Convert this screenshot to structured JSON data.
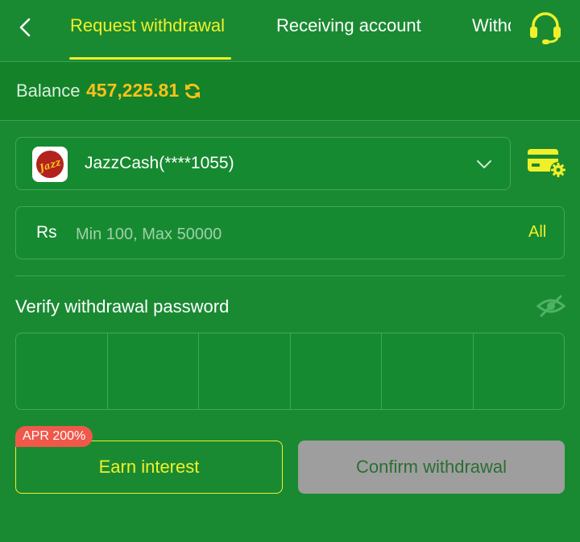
{
  "header": {
    "back_icon": "chevron-left-icon",
    "tabs": [
      {
        "label": "Request withdrawal",
        "active": true
      },
      {
        "label": "Receiving account",
        "active": false
      },
      {
        "label": "Withdrawal history",
        "active": false
      }
    ],
    "support_icon": "headset-icon"
  },
  "balance": {
    "label": "Balance",
    "value": "457,225.81",
    "refresh_icon": "refresh-icon"
  },
  "account": {
    "logo_text": "Jazz",
    "name": "JazzCash(****1055)",
    "dropdown_icon": "chevron-down-icon",
    "manage_icon": "card-settings-icon"
  },
  "amount": {
    "currency": "Rs",
    "placeholder": "Min 100, Max 50000",
    "value": "",
    "all_label": "All"
  },
  "password": {
    "label": "Verify withdrawal password",
    "visibility_icon": "eye-off-icon",
    "digits": [
      "",
      "",
      "",
      "",
      "",
      ""
    ]
  },
  "actions": {
    "apr_badge": "APR 200%",
    "earn_label": "Earn interest",
    "confirm_label": "Confirm withdrawal"
  },
  "colors": {
    "background": "#1a8a32",
    "accent_yellow": "#f0f02a",
    "balance_gold": "#f7c21a",
    "badge_red": "#f0584a",
    "disabled_gray": "#9e9e9e"
  }
}
